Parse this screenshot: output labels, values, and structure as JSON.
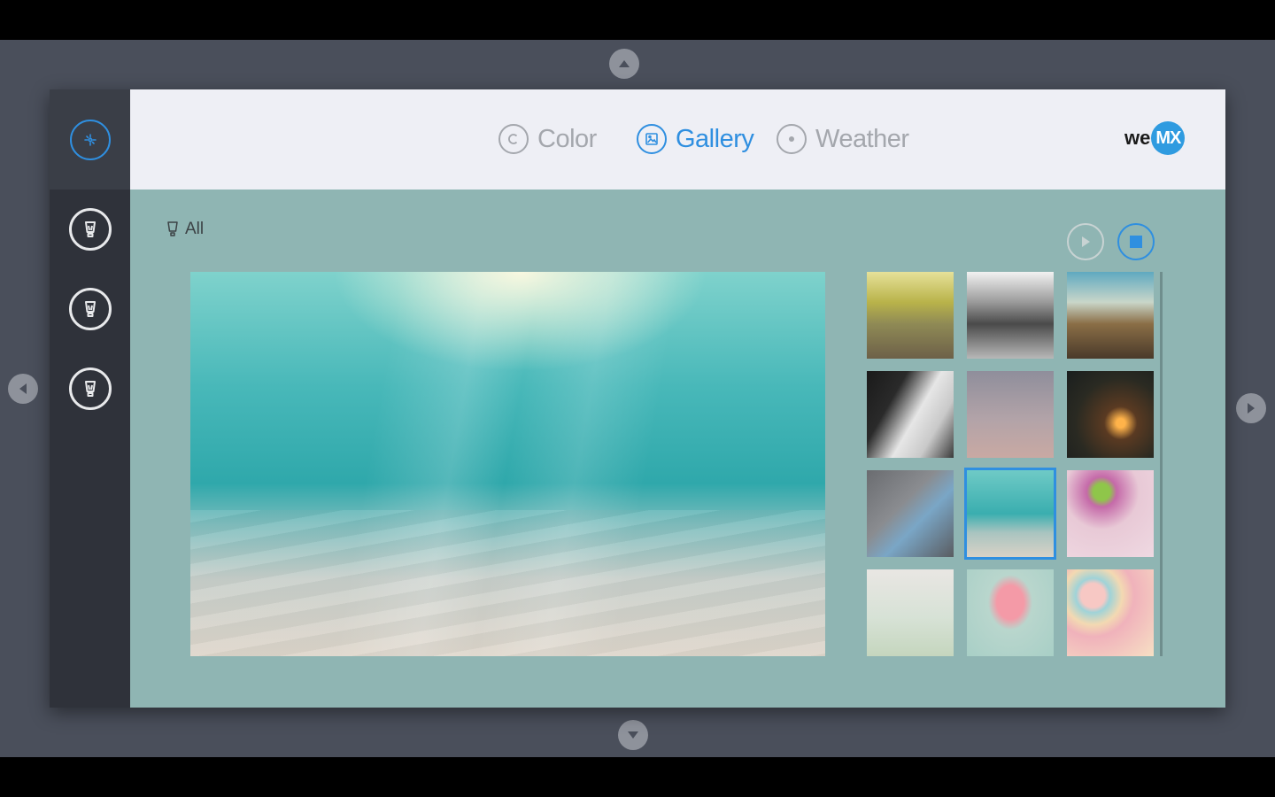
{
  "tabs": [
    {
      "label": "Color",
      "icon": "copyright-icon"
    },
    {
      "label": "Gallery",
      "icon": "image-icon"
    },
    {
      "label": "Weather",
      "icon": "sun-icon"
    }
  ],
  "active_tab": "Gallery",
  "logo": {
    "prefix": "we",
    "badge": "MX"
  },
  "filter": {
    "label": "All",
    "icon": "bulb-icon"
  },
  "colors": {
    "accent": "#2f8fe0",
    "content_bg": "#8fb5b3",
    "sidebar_bg": "#2f323a",
    "topbar_bg": "#eeeff5"
  },
  "thumbnails": [
    {
      "name": "thumb-field-sunset",
      "bg": "linear-gradient(180deg,#e6e199 0%,#b9b34a 35%,#8f8a55 60%,#6d6048 100%)"
    },
    {
      "name": "thumb-city-canal-bw",
      "bg": "linear-gradient(180deg,#f2f2f2 0%,#9a9a9a 35%,#4a4a4a 60%,#b8b8b8 100%)"
    },
    {
      "name": "thumb-city-skyline",
      "bg": "linear-gradient(180deg,#5fa9c0 0%,#c9d6c9 35%,#8a6e46 60%,#4a3a2a 100%)"
    },
    {
      "name": "thumb-handwritten-note",
      "bg": "linear-gradient(120deg,#1a1a1a 0%,#2a2a2a 30%,#e6e6e6 55%,#c9c9c9 75%,#3a3a3a 100%)"
    },
    {
      "name": "thumb-purple-haze",
      "bg": "linear-gradient(180deg,#8f8e9b 0%,#b2a3a8 55%,#c9a9a3 100%)"
    },
    {
      "name": "thumb-sparkler-hand",
      "bg": "radial-gradient(circle at 62% 60%,#ffb34a 0 6%,#5a3a22 22%,#2a2a22 60%,#1a1e1e 100%)"
    },
    {
      "name": "thumb-you-and-me",
      "bg": "linear-gradient(135deg,#6a6c70 0%,#8a8c90 40%,#7aa6c6 60%,#5a5c60 100%)"
    },
    {
      "name": "thumb-underwater",
      "bg": "linear-gradient(180deg,#6fcac6 0%,#3aaeaf 50%,#a9c4c0 72%,#d9d2c6 100%)",
      "selected": true
    },
    {
      "name": "thumb-flowers-gift",
      "bg": "radial-gradient(circle at 40% 25%,#8fc64a 0 10%,#c56aa9 18%,#e8c9d6 45%,#efd9e2 100%)"
    },
    {
      "name": "thumb-pastel-blur",
      "bg": "linear-gradient(180deg,#e9e6e3 0%,#d7e2d6 55%,#c5d6be 100%)"
    },
    {
      "name": "thumb-ice-cream-cone",
      "bg": "radial-gradient(ellipse at 50% 38%,#f49aa7 0 22%,#b9d6cd 36%,#a8cfc6 100%)"
    },
    {
      "name": "thumb-macarons",
      "bg": "radial-gradient(circle at 30% 30%,#f7c8c4 0 14%,#9fd3d8 20%,#f3d9b2 34%,#f0b2bb 48%,#f7e0c4 100%)"
    }
  ]
}
